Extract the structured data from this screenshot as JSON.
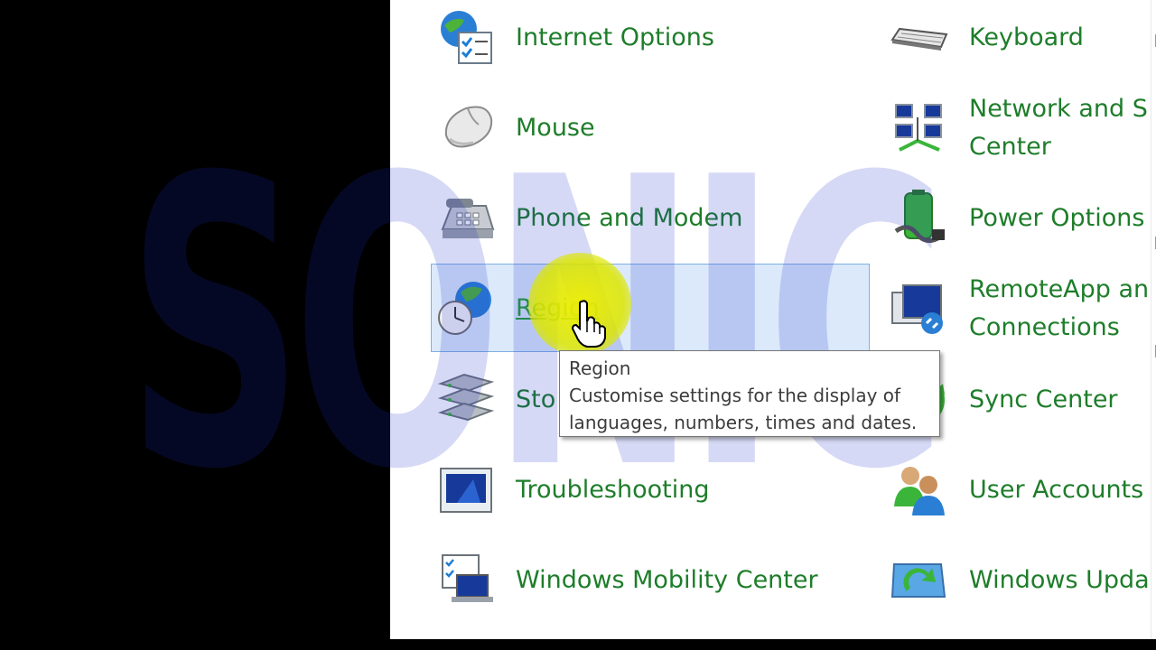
{
  "items": [
    {
      "label": "Internet Options",
      "icon": "internet-options-icon"
    },
    {
      "label": "Keyboard",
      "icon": "keyboard-icon"
    },
    {
      "label": "Mouse",
      "icon": "mouse-icon"
    },
    {
      "label": "Network and S Center",
      "line1": "Network and S",
      "line2": "Center",
      "icon": "network-center-icon"
    },
    {
      "label": "Phone and Modem",
      "icon": "phone-icon"
    },
    {
      "label": "Power Options",
      "icon": "power-options-icon"
    },
    {
      "label": "Region",
      "icon": "region-icon"
    },
    {
      "label": "RemoteApp an Connections",
      "line1": "RemoteApp an",
      "line2": "Connections",
      "icon": "remoteapp-icon"
    },
    {
      "label": "Sto",
      "icon": "storage-spaces-icon"
    },
    {
      "label": "Sync Center",
      "icon": "sync-center-icon"
    },
    {
      "label": "Troubleshooting",
      "icon": "troubleshooting-icon"
    },
    {
      "label": "User Accounts",
      "icon": "user-accounts-icon"
    },
    {
      "label": "Windows Mobility Center",
      "icon": "mobility-center-icon"
    },
    {
      "label": "Windows Upda",
      "icon": "windows-update-icon"
    }
  ],
  "tooltip": {
    "title": "Region",
    "description": "Customise settings for the display of languages, numbers, times and dates."
  },
  "watermark": "SONIC",
  "colors": {
    "link": "#1e7d2a",
    "selection": "#dbe9fb",
    "selection_border": "#7fb0e3",
    "highlight": "#f0f000"
  }
}
